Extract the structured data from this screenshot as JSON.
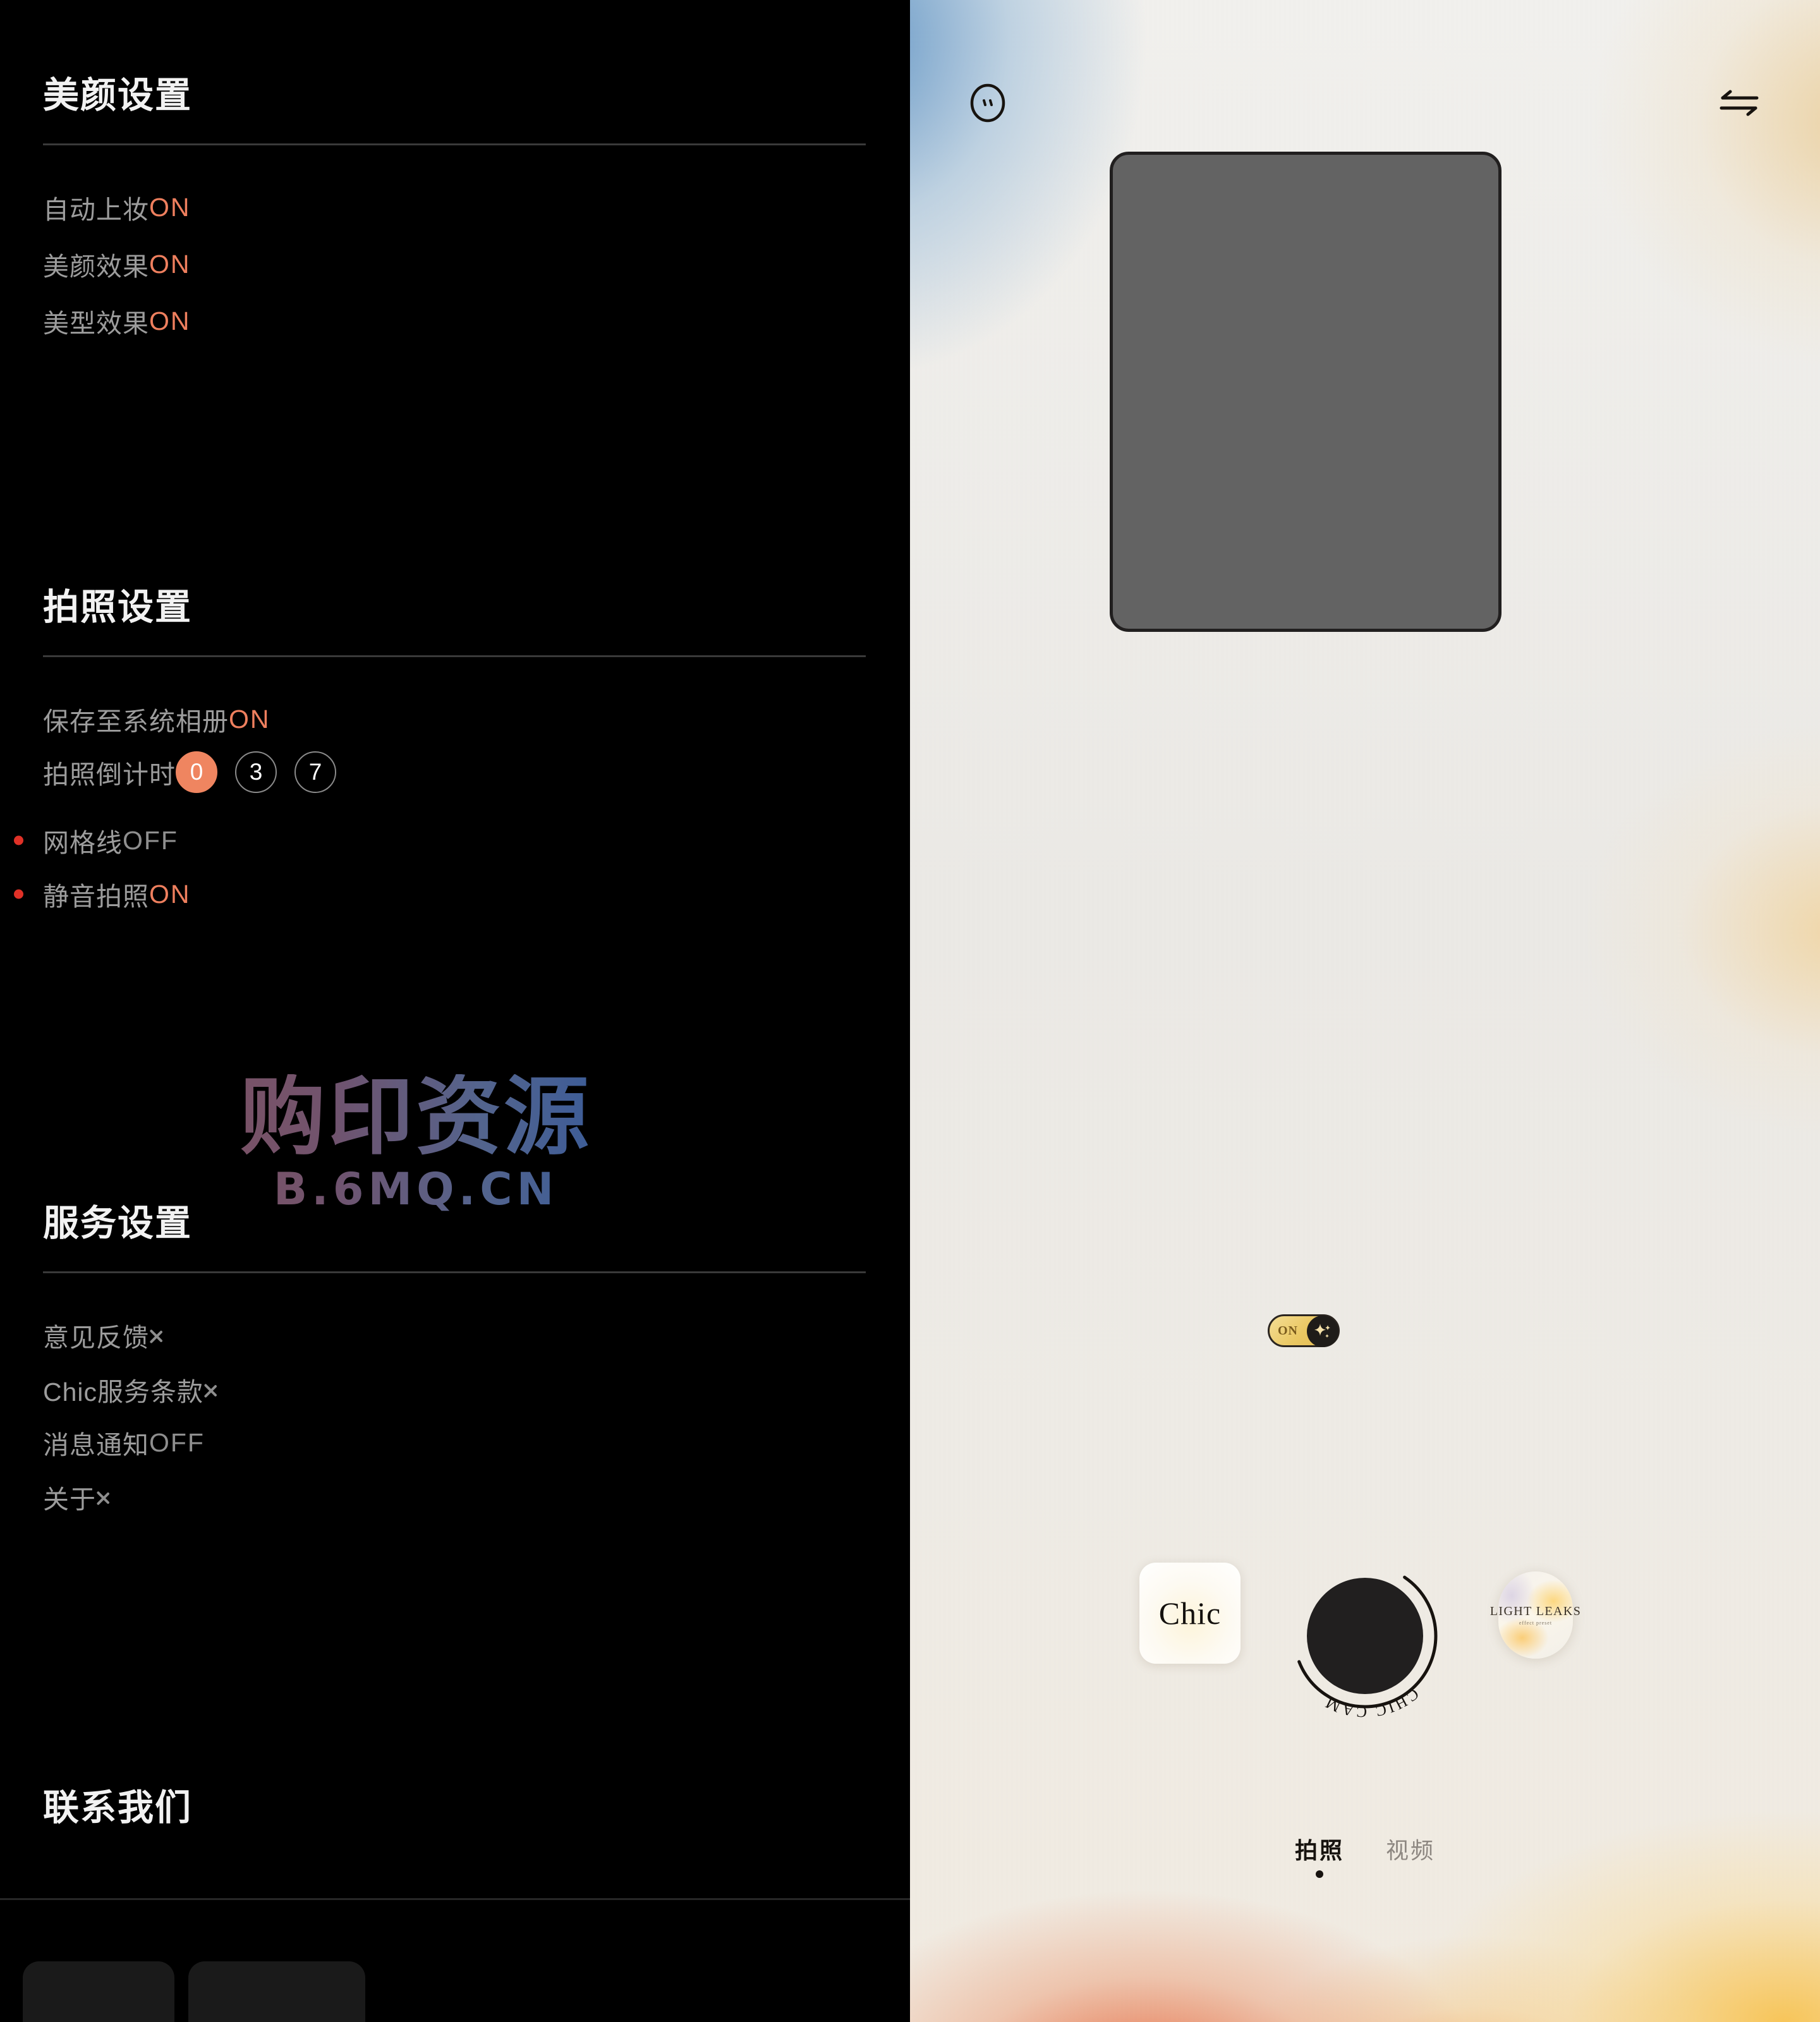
{
  "settings": {
    "sections": [
      {
        "title": "美颜设置",
        "rows": [
          {
            "label": "自动上妆",
            "value": "ON",
            "state": "on",
            "dot": false,
            "chevron": false
          },
          {
            "label": "美颜效果",
            "value": "ON",
            "state": "on",
            "dot": false,
            "chevron": false
          },
          {
            "label": "美型效果",
            "value": "ON",
            "state": "on",
            "dot": false,
            "chevron": false
          }
        ]
      },
      {
        "title": "拍照设置",
        "rows": [
          {
            "label": "保存至系统相册",
            "value": "ON",
            "state": "on",
            "dot": false,
            "chevron": false
          },
          {
            "label": "拍照倒计时",
            "value": "",
            "state": "chips",
            "dot": false,
            "chevron": false
          },
          {
            "label": "网格线",
            "value": "OFF",
            "state": "off",
            "dot": true,
            "chevron": false
          },
          {
            "label": "静音拍照",
            "value": "ON",
            "state": "on",
            "dot": true,
            "chevron": false
          }
        ]
      },
      {
        "title": "服务设置",
        "rows": [
          {
            "label": "意见反馈",
            "value": "",
            "state": "link",
            "dot": false,
            "chevron": true
          },
          {
            "label": "Chic服务条款",
            "value": "",
            "state": "link",
            "dot": false,
            "chevron": true
          },
          {
            "label": "消息通知",
            "value": "OFF",
            "state": "off",
            "dot": false,
            "chevron": false
          },
          {
            "label": "关于",
            "value": "",
            "state": "link",
            "dot": false,
            "chevron": true
          }
        ]
      },
      {
        "title": "联系我们",
        "rows": []
      }
    ],
    "countdown": {
      "options": [
        "0",
        "3",
        "7"
      ],
      "selected": "0"
    },
    "colors": {
      "accent_on": "#ee7f5e",
      "value_off": "#8e8e8e",
      "badge_dot": "#e03127",
      "chip_active": "#ef8560",
      "panel_bg": "#000000"
    }
  },
  "watermark": {
    "main": "购印资源",
    "sub": "B.6MQ.CN"
  },
  "camera": {
    "top_bar": {
      "face_icon": "face-smiley-icon",
      "swap_icon": "camera-flip-icon"
    },
    "viewfinder": {
      "label": "camera-preview",
      "fill": "#636363",
      "border": "#211f1f"
    },
    "beauty_toggle": {
      "label": "ON",
      "icon": "sparkle-icon",
      "state": "on",
      "track_color": "#eac863",
      "knob_color": "#1f1c19"
    },
    "controls": {
      "filter_card_label": "Chic",
      "shutter_ring_text": "CHIC CAM",
      "light_leaks_label": "LIGHT LEAKS",
      "light_leaks_sub": "effect preset"
    },
    "tabs": [
      {
        "label": "拍照",
        "active": true
      },
      {
        "label": "视频",
        "active": false
      }
    ]
  }
}
